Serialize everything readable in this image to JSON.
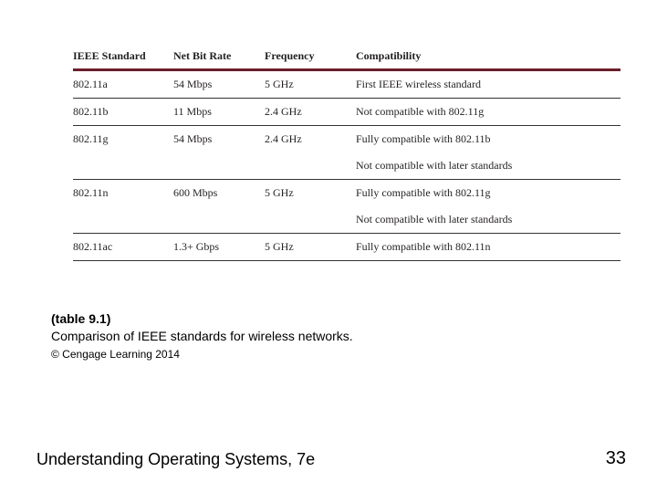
{
  "table": {
    "headers": [
      "IEEE Standard",
      "Net Bit Rate",
      "Frequency",
      "Compatibility"
    ],
    "rows": [
      {
        "cells": [
          "802.11a",
          "54 Mbps",
          "5 GHz",
          "First IEEE wireless standard"
        ],
        "rule": true
      },
      {
        "cells": [
          "802.11b",
          "11 Mbps",
          "2.4 GHz",
          "Not compatible with 802.11g"
        ],
        "rule": true
      },
      {
        "cells": [
          "802.11g",
          "54 Mbps",
          "2.4 GHz",
          "Fully compatible with 802.11b"
        ],
        "rule": false
      },
      {
        "cells": [
          "",
          "",
          "",
          "Not compatible with later standards"
        ],
        "rule": true
      },
      {
        "cells": [
          "802.11n",
          "600 Mbps",
          "5 GHz",
          "Fully compatible with 802.11g"
        ],
        "rule": false
      },
      {
        "cells": [
          "",
          "",
          "",
          "Not compatible with later standards"
        ],
        "rule": true
      },
      {
        "cells": [
          "802.11ac",
          "1.3+ Gbps",
          "5 GHz",
          "Fully compatible with 802.11n"
        ],
        "rule": true
      }
    ]
  },
  "caption": {
    "label": "(table 9.1)",
    "text": "Comparison of IEEE standards for wireless networks.",
    "copyright": "© Cengage Learning 2014"
  },
  "footer": {
    "title": "Understanding Operating Systems, 7e",
    "page": "33"
  },
  "chart_data": {
    "type": "table",
    "title": "Comparison of IEEE standards for wireless networks (table 9.1)",
    "columns": [
      "IEEE Standard",
      "Net Bit Rate",
      "Frequency",
      "Compatibility"
    ],
    "rows": [
      [
        "802.11a",
        "54 Mbps",
        "5 GHz",
        "First IEEE wireless standard"
      ],
      [
        "802.11b",
        "11 Mbps",
        "2.4 GHz",
        "Not compatible with 802.11g"
      ],
      [
        "802.11g",
        "54 Mbps",
        "2.4 GHz",
        "Fully compatible with 802.11b; Not compatible with later standards"
      ],
      [
        "802.11n",
        "600 Mbps",
        "5 GHz",
        "Fully compatible with 802.11g; Not compatible with later standards"
      ],
      [
        "802.11ac",
        "1.3+ Gbps",
        "5 GHz",
        "Fully compatible with 802.11n"
      ]
    ]
  }
}
